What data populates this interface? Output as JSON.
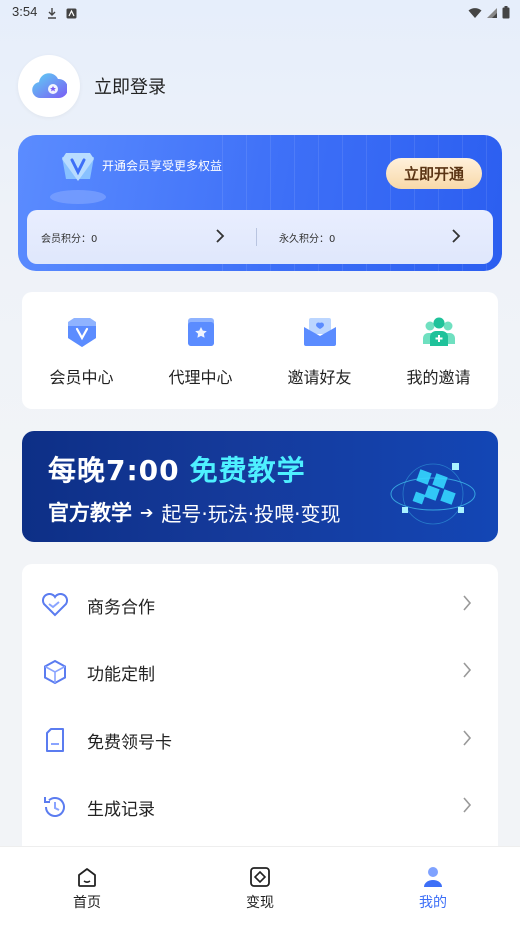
{
  "status_bar": {
    "time": "3:54"
  },
  "profile": {
    "login_text": "立即登录"
  },
  "vip": {
    "promo_text": "开通会员享受更多权益",
    "open_button": "立即开通",
    "member_points": "会员积分：0",
    "permanent_points": "永久积分：0"
  },
  "quick_actions": [
    {
      "label": "会员中心",
      "icon": "member-center-icon"
    },
    {
      "label": "代理中心",
      "icon": "agent-center-icon"
    },
    {
      "label": "邀请好友",
      "icon": "invite-friends-icon"
    },
    {
      "label": "我的邀请",
      "icon": "my-invites-icon"
    }
  ],
  "banner": {
    "line1_prefix": "每晚7:00",
    "line1_highlight": "免费教学",
    "tag": "官方教学",
    "subtitle": "起号·玩法·投喂·变现"
  },
  "menu": [
    {
      "label": "商务合作",
      "icon": "handshake-heart-icon"
    },
    {
      "label": "功能定制",
      "icon": "cube-icon"
    },
    {
      "label": "免费领号卡",
      "icon": "sim-card-icon"
    },
    {
      "label": "生成记录",
      "icon": "history-icon"
    }
  ],
  "tabbar": [
    {
      "label": "首页",
      "icon": "home-icon",
      "active": false
    },
    {
      "label": "变现",
      "icon": "monetize-icon",
      "active": false
    },
    {
      "label": "我的",
      "icon": "profile-icon",
      "active": true
    }
  ],
  "colors": {
    "accent": "#3d6ff7",
    "banner_highlight": "#4ef0ff"
  }
}
